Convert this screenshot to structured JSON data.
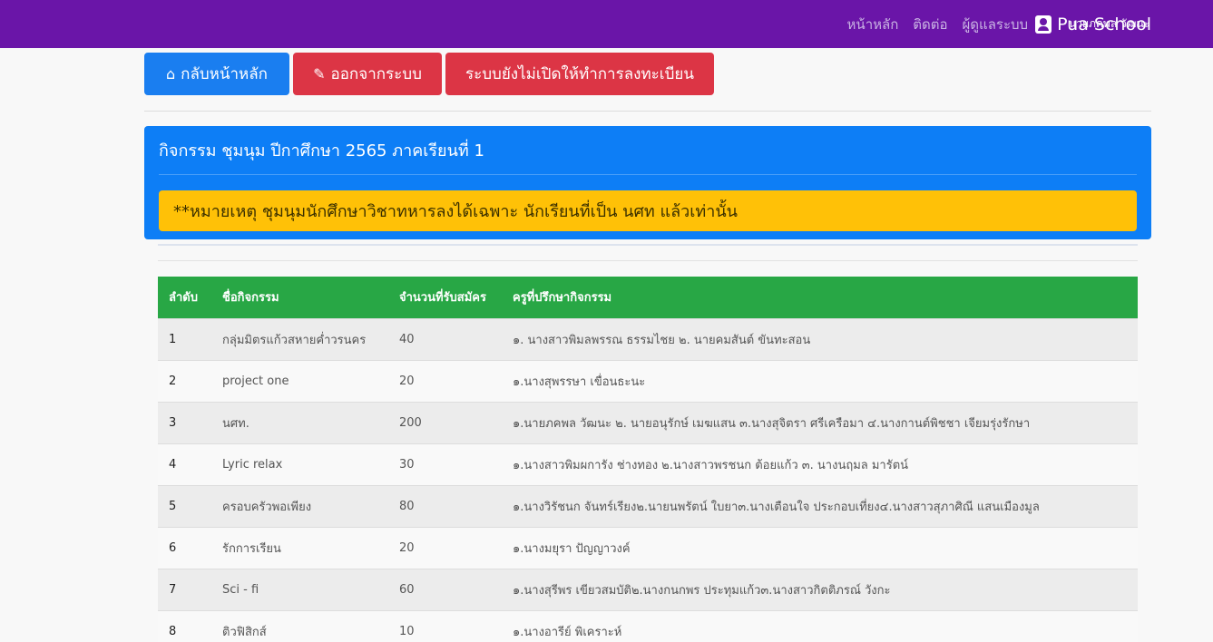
{
  "nav": {
    "links": [
      "หน้าหลัก",
      "ติดต่อ",
      "ผู้ดูแลระบบ"
    ],
    "brand": "Pua School",
    "user": "นายภคพล วัฒนะ"
  },
  "actions": {
    "home": "กลับหน้าหลัก",
    "logout": "ออกจากระบบ",
    "closed": "ระบบยังไม่เปิดให้ทำการลงทะเบียน"
  },
  "panel": {
    "title": "กิจกรรม ชุมนุม ปีกาศึกษา 2565 ภาคเรียนที่ 1",
    "alert": "**หมายเหตุ ชุมนุมนักศึกษาวิชาทหารลงได้เฉพาะ นักเรียนที่เป็น นศท แล้วเท่านั้น"
  },
  "table": {
    "headers": [
      "ลำดับ",
      "ชื่อกิจกรรม",
      "จำนวนที่รับสมัคร",
      "ครูที่ปรึกษากิจกรรม"
    ],
    "rows": [
      [
        "1",
        "กลุ่มมิตรแก้วสหายค่ำวรนคร",
        "40",
        "๑. นางสาวพิมลพรรณ ธรรมไชย ๒. นายคมสันต์ ขันทะสอน"
      ],
      [
        "2",
        "project one",
        "20",
        "๑.นางสุพรรษา เขื่อนธะนะ"
      ],
      [
        "3",
        "นศท.",
        "200",
        "๑.นายภคพล วัฒนะ ๒. นายอนุรักษ์ เมฆแสน ๓.นางสุจิตรา ศรีเครือมา ๔.นางกานต์พิชชา เจียมรุ่งรักษา"
      ],
      [
        "4",
        "Lyric relax",
        "30",
        "๑.นางสาวพิมผการัง ช่างทอง ๒.นางสาวพรชนก ต้อยแก้ว ๓. นางนฤมล มารัตน์"
      ],
      [
        "5",
        "ครอบครัวพอเพียง",
        "80",
        "๑.นางวิรัชนก จันทร์เรียง๒.นายนพรัตน์ ใบยา๓.นางเตือนใจ ประกอบเที่ยง๔.นางสาวสุภาศิณี แสนเมืองมูล"
      ],
      [
        "6",
        "รักการเรียน",
        "20",
        "๑.นางมยุรา ปัญญาวงค์"
      ],
      [
        "7",
        "Sci - fi",
        "60",
        "๑.นางสุรีพร เขียวสมบัติ๒.นางกนกพร ประทุมแก้ว๓.นางสาวกิตติภรณ์ วังกะ"
      ],
      [
        "8",
        "ติวฟิสิกส์",
        "10",
        "๑.นางอารีย์ พิเคราะห์"
      ]
    ]
  }
}
